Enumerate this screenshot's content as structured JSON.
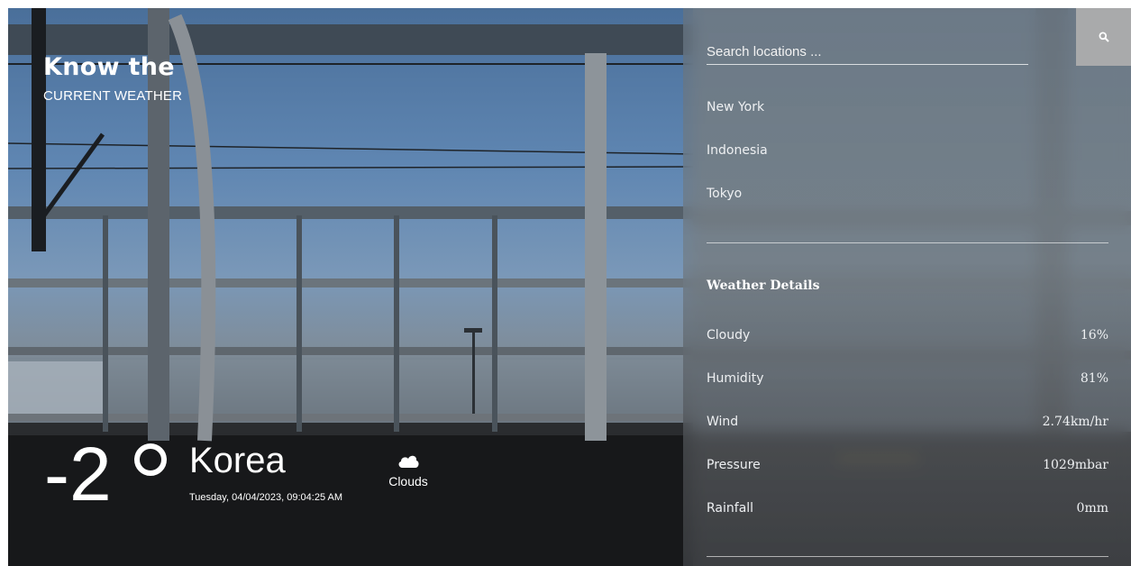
{
  "brand": {
    "title": "Know the",
    "subtitle": "CURRENT WEATHER"
  },
  "current": {
    "temperature": "-2",
    "city": "Korea",
    "datetime": "Tuesday, 04/04/2023, 09:04:25 AM",
    "condition": "Clouds",
    "condition_icon": "cloud-icon"
  },
  "search": {
    "placeholder": "Search locations ...",
    "value": "",
    "icon": "search-icon"
  },
  "locations": [
    "New York",
    "Indonesia",
    "Tokyo"
  ],
  "details": {
    "title": "Weather Details",
    "rows": [
      {
        "label": "Cloudy",
        "value": "16%"
      },
      {
        "label": "Humidity",
        "value": "81%"
      },
      {
        "label": "Wind",
        "value": "2.74km/hr"
      },
      {
        "label": "Pressure",
        "value": "1029mbar"
      },
      {
        "label": "Rainfall",
        "value": "0mm"
      }
    ]
  }
}
